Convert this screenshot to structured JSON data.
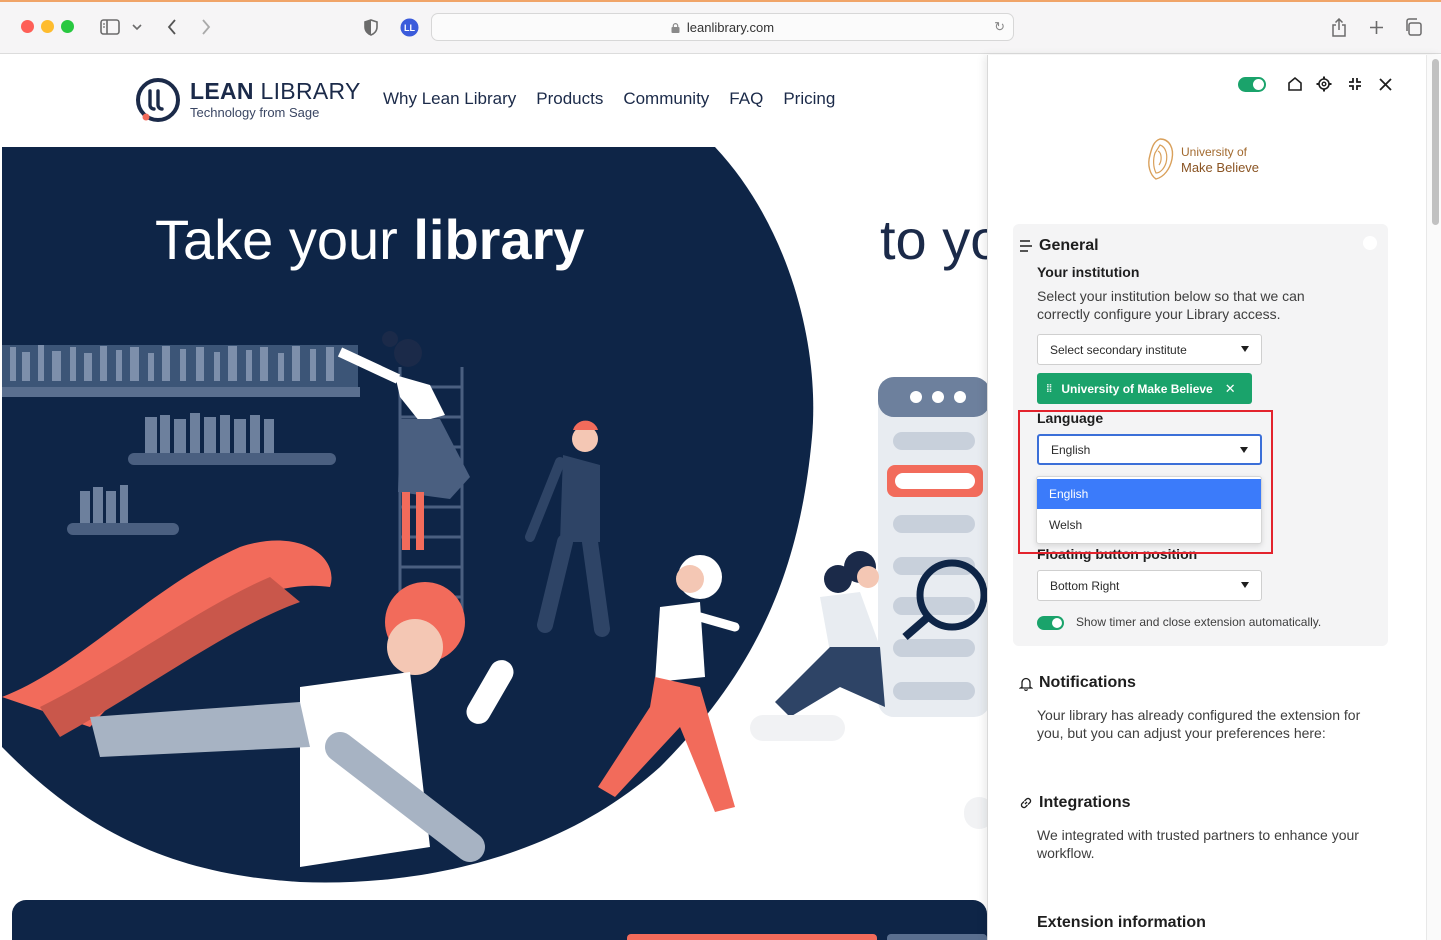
{
  "browser": {
    "url": "leanlibrary.com"
  },
  "site": {
    "logo_bold": "LEAN",
    "logo_rest": "LIBRARY",
    "logo_tagline": "Technology from Sage",
    "nav": [
      "Why Lean Library",
      "Products",
      "Community",
      "FAQ",
      "Pricing"
    ],
    "hero_title_light": "Take your",
    "hero_title_bold": "library",
    "hero_title_right": "to yo"
  },
  "panel": {
    "institution_line1": "University of",
    "institution_line2": "Make Believe",
    "general": {
      "title": "General",
      "your_institution_heading": "Your institution",
      "your_institution_text": "Select your institution below so that we can correctly configure your Library access.",
      "secondary_select_placeholder": "Select secondary institute",
      "selected_institution_tag": "University of Make Believe",
      "language_heading": "Language",
      "language_value": "English",
      "language_options": [
        "English",
        "Welsh"
      ],
      "floating_heading": "Floating button position",
      "floating_value": "Bottom Right",
      "timer_text": "Show timer and close extension automatically."
    },
    "notifications": {
      "title": "Notifications",
      "text": "Your library has already configured the extension for you, but you can adjust your preferences here:"
    },
    "integrations": {
      "title": "Integrations",
      "text": "We integrated with trusted partners to enhance your workflow."
    },
    "extension_info": {
      "title": "Extension information"
    }
  },
  "colors": {
    "accent_green": "#1aa36b",
    "highlight_red": "#e3232d",
    "navy": "#0e2547",
    "coral": "#f26b5b",
    "select_blue": "#3b7bfa"
  }
}
